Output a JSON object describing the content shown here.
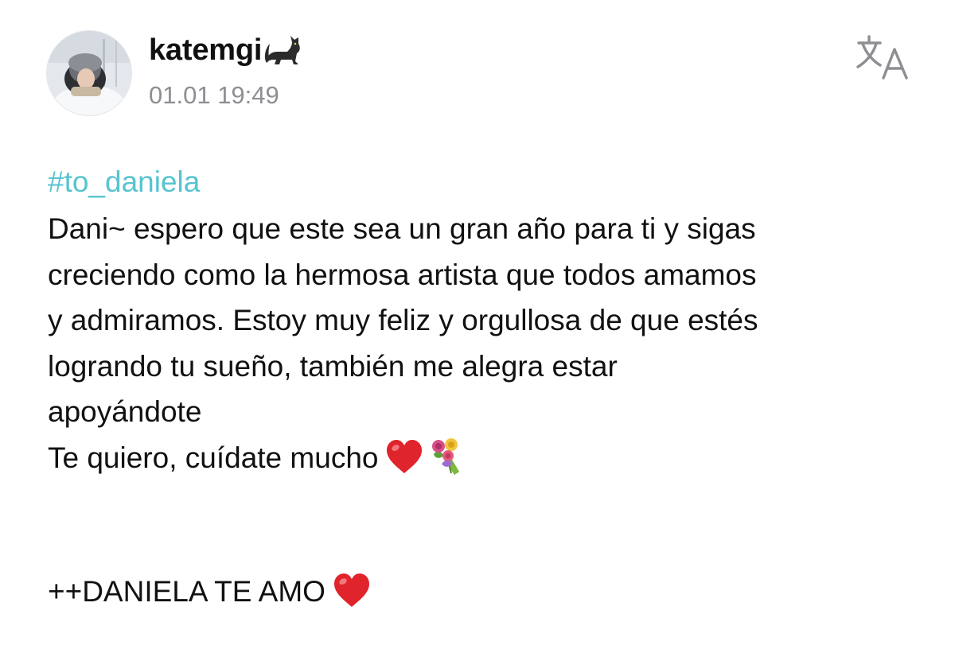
{
  "post": {
    "author": {
      "username": "katemgi",
      "username_emoji": "black-cat-emoji",
      "avatar": "profile-photo-avatar"
    },
    "timestamp": "01.01 19:49",
    "translate_icon": "translate-icon",
    "hashtag": "#to_daniela",
    "body_lines": [
      "Dani~ espero que este sea un gran año para ti y sigas",
      "creciendo como la hermosa artista que todos amamos",
      "y admiramos. Estoy muy feliz y orgullosa de que estés",
      "logrando tu sueño, también me alegra estar",
      "apoyándote",
      "Te quiero, cuídate mucho"
    ],
    "body_emojis": [
      "red-heart-emoji",
      "bouquet-emoji"
    ],
    "closing_line": "++DANIELA TE AMO",
    "closing_emoji": "red-heart-emoji"
  },
  "colors": {
    "hashtag": "#56c4cf",
    "timestamp": "#8e8e93",
    "text": "#111111",
    "heart": "#e0242b"
  }
}
